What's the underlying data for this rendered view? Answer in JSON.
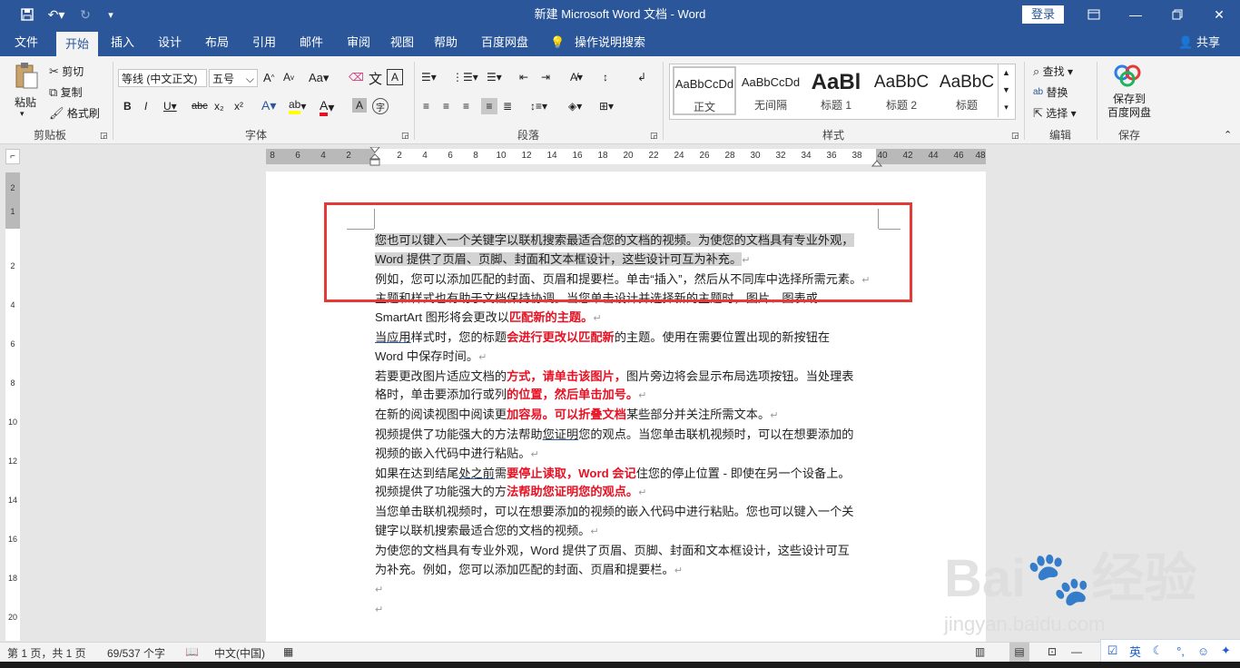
{
  "window": {
    "title": "新建 Microsoft Word 文档  -  Word",
    "login": "登录"
  },
  "tabs": [
    "文件",
    "开始",
    "插入",
    "设计",
    "布局",
    "引用",
    "邮件",
    "审阅",
    "视图",
    "帮助",
    "百度网盘",
    "操作说明搜索"
  ],
  "share": "共享",
  "ribbon": {
    "clipboard": {
      "paste": "粘贴",
      "cut": "剪切",
      "copy": "复制",
      "format_painter": "格式刷",
      "label": "剪贴板"
    },
    "font": {
      "family": "等线 (中文正文)",
      "size": "五号",
      "label": "字体"
    },
    "paragraph": {
      "label": "段落"
    },
    "styles": {
      "label": "样式",
      "items": [
        {
          "preview": "AaBbCcDd",
          "name": "正文"
        },
        {
          "preview": "AaBbCcDd",
          "name": "无间隔"
        },
        {
          "preview": "AaBl",
          "name": "标题 1"
        },
        {
          "preview": "AaBbC",
          "name": "标题 2"
        },
        {
          "preview": "AaBbC",
          "name": "标题"
        }
      ]
    },
    "editing": {
      "find": "查找",
      "replace": "替换",
      "select": "选择",
      "label": "编辑"
    },
    "save": {
      "button": "保存到\n百度网盘",
      "label": "保存"
    }
  },
  "ruler": {
    "left_marks": [
      "8",
      "6",
      "4",
      "2"
    ],
    "marks": [
      "2",
      "4",
      "6",
      "8",
      "10",
      "12",
      "14",
      "16",
      "18",
      "20",
      "22",
      "24",
      "26",
      "28",
      "30",
      "32",
      "34",
      "36",
      "38",
      "40",
      "42",
      "44",
      "46",
      "48"
    ],
    "vmarks": [
      "2",
      "1",
      "2",
      "4",
      "6",
      "8",
      "10",
      "12",
      "14",
      "16",
      "18",
      "20"
    ]
  },
  "document": {
    "paragraphs": [
      [
        {
          "t": "您也可以键入一个关键字以联机搜索最适合您的文档的视频。为使您的文档具有专业外观，",
          "s": "hl"
        }
      ],
      [
        {
          "t": "Word 提供了页眉、页脚、封面和文本框设计，这些设计可互为补充。",
          "s": "hl"
        },
        {
          "t": "↵",
          "s": "pm"
        }
      ],
      [
        {
          "t": "例如，您可以添加匹配的封面、页眉和提要栏。单击“插入”，然后从不同库中选择所需元素。",
          "s": ""
        },
        {
          "t": "↵",
          "s": "pm"
        }
      ],
      [
        {
          "t": "主题和样式也有助于文档保持协调。当您单击设计并选择新的主题时，图片、图表或",
          "s": ""
        }
      ],
      [
        {
          "t": "SmartArt 图形将会更改以",
          "s": ""
        },
        {
          "t": "匹配新的主题。",
          "s": "red"
        },
        {
          "t": "↵",
          "s": "pm"
        }
      ],
      [
        {
          "t": "当应用",
          "s": "ul"
        },
        {
          "t": "样式时，您的标题",
          "s": ""
        },
        {
          "t": "会进行更改以匹配新",
          "s": "red"
        },
        {
          "t": "的主题。使用在需要位置出现的新按钮在",
          "s": ""
        }
      ],
      [
        {
          "t": "Word 中保存时间。",
          "s": ""
        },
        {
          "t": "↵",
          "s": "pm"
        }
      ],
      [
        {
          "t": "若要更改图片适应文档的",
          "s": ""
        },
        {
          "t": "方式，请单击该图片，",
          "s": "red"
        },
        {
          "t": "图片旁边将会显示布局选项按钮。当处理表",
          "s": ""
        }
      ],
      [
        {
          "t": "格时，单击要添加行或列",
          "s": ""
        },
        {
          "t": "的位置，然后单击加号。",
          "s": "red"
        },
        {
          "t": "↵",
          "s": "pm"
        }
      ],
      [
        {
          "t": "在新的阅读视图中阅读更",
          "s": ""
        },
        {
          "t": "加容易。可以折叠文档",
          "s": "red"
        },
        {
          "t": "某些部分并关注所需文本。",
          "s": ""
        },
        {
          "t": "↵",
          "s": "pm"
        }
      ],
      [
        {
          "t": "视频提供了功能强大的方法帮助",
          "s": ""
        },
        {
          "t": "您证明",
          "s": "ul"
        },
        {
          "t": "您的观点。当您单击联机视频时，可以在想要添加的",
          "s": ""
        }
      ],
      [
        {
          "t": "视频的嵌入代码中进行粘贴。",
          "s": ""
        },
        {
          "t": "↵",
          "s": "pm"
        }
      ],
      [
        {
          "t": "如果在达到结尾",
          "s": ""
        },
        {
          "t": "处之前",
          "s": "ul"
        },
        {
          "t": "需",
          "s": ""
        },
        {
          "t": "要停止读取，Word 会记",
          "s": "red"
        },
        {
          "t": "住您的停止位置 - 即使在另一个设备上。",
          "s": ""
        }
      ],
      [
        {
          "t": "视频提供了功能强大的方",
          "s": ""
        },
        {
          "t": "法帮助您证明您的观点。",
          "s": "red"
        },
        {
          "t": "↵",
          "s": "pm"
        }
      ],
      [
        {
          "t": "当您单击联机视频时，可以在想要添加的视频的嵌入代码中进行粘贴。您也可以键入一个关",
          "s": ""
        }
      ],
      [
        {
          "t": "键字以联机搜索最适合您的文档的视频。",
          "s": ""
        },
        {
          "t": "↵",
          "s": "pm"
        }
      ],
      [
        {
          "t": "为使您的文档具有专业外观，Word 提供了页眉、页脚、封面和文本框设计，这些设计可互",
          "s": ""
        }
      ],
      [
        {
          "t": "为补充。例如，您可以添加匹配的封面、页眉和提要栏。",
          "s": ""
        },
        {
          "t": "↵",
          "s": "pm"
        }
      ],
      [
        {
          "t": "↵",
          "s": "pm"
        }
      ],
      [
        {
          "t": "↵",
          "s": "pm"
        }
      ]
    ]
  },
  "status": {
    "page": "第 1 页，共 1 页",
    "words": "69/537 个字",
    "lang": "中文(中国)"
  },
  "ime": [
    "英",
    "☾",
    "°,",
    "☺",
    "✦"
  ],
  "watermark": {
    "logo": "Bai🐾经验",
    "url": "jingyan.baidu.com"
  },
  "colors": {
    "accent": "#2b579a",
    "highlight_box": "#e53935",
    "red_text": "#e81123"
  }
}
